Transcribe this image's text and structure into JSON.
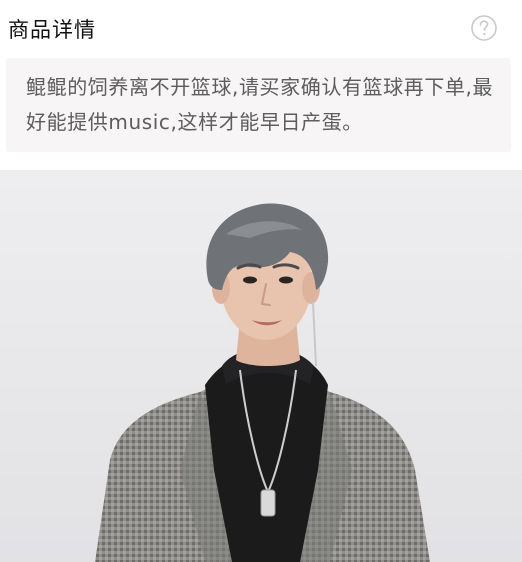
{
  "header": {
    "title": "商品详情",
    "help_icon": "question-circle-icon"
  },
  "description": {
    "text": "鲲鲲的饲养离不开篮球,请买家确认有篮球再下单,最好能提供music,这样才能早日产蛋。"
  },
  "photo": {
    "subject": "product-photo",
    "colors": {
      "background": "#ebebed",
      "hair": "#6f7277",
      "skin": "#e8c3ae",
      "coat": "#8d8c89",
      "sweater": "#1b1b1c"
    }
  }
}
